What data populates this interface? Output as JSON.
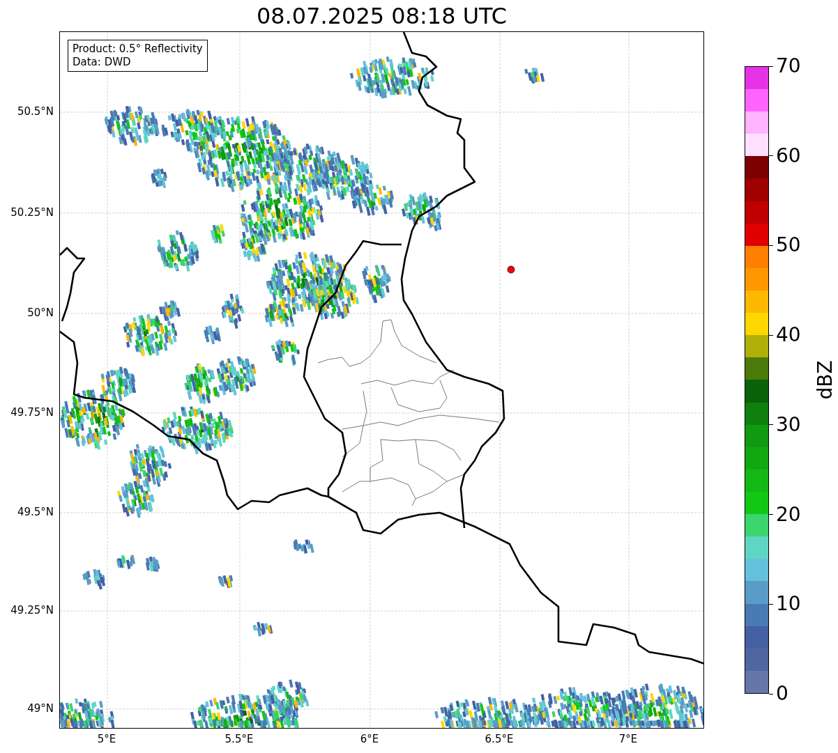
{
  "title": "08.07.2025 08:18 UTC",
  "map": {
    "info_box": [
      "Product: 0.5° Reflectivity",
      "Data: DWD"
    ],
    "lat_labels": [
      "50.5°N",
      "50.25°N",
      "50°N",
      "49.75°N",
      "49.5°N",
      "49.25°N",
      "49°N"
    ],
    "lon_labels": [
      "5°E",
      "5.5°E",
      "6°E",
      "6.5°E",
      "7°E"
    ]
  },
  "colorbar": {
    "label": "dBZ",
    "ticks": [
      "70",
      "60",
      "50",
      "40",
      "30",
      "20",
      "10",
      "0"
    ],
    "segments": [
      {
        "color": "#6577a8"
      },
      {
        "color": "#5066a0"
      },
      {
        "color": "#4560a3"
      },
      {
        "color": "#4a7ab4"
      },
      {
        "color": "#5a9cc8"
      },
      {
        "color": "#65c0dc"
      },
      {
        "color": "#5fd6c4"
      },
      {
        "color": "#3cd46c"
      },
      {
        "color": "#12c812"
      },
      {
        "color": "#14b814"
      },
      {
        "color": "#12a812"
      },
      {
        "color": "#109a10"
      },
      {
        "color": "#0e800e"
      },
      {
        "color": "#0a620a"
      },
      {
        "color": "#4a7a0a"
      },
      {
        "color": "#b0b00a"
      },
      {
        "color": "#ffd700"
      },
      {
        "color": "#ffb800"
      },
      {
        "color": "#ff9800"
      },
      {
        "color": "#ff7f00"
      },
      {
        "color": "#e00000"
      },
      {
        "color": "#c00000"
      },
      {
        "color": "#a00000"
      },
      {
        "color": "#7c0000"
      },
      {
        "color": "#ffe0ff"
      },
      {
        "color": "#ffb4ff"
      },
      {
        "color": "#ff64ff"
      },
      {
        "color": "#e632e6"
      }
    ]
  }
}
